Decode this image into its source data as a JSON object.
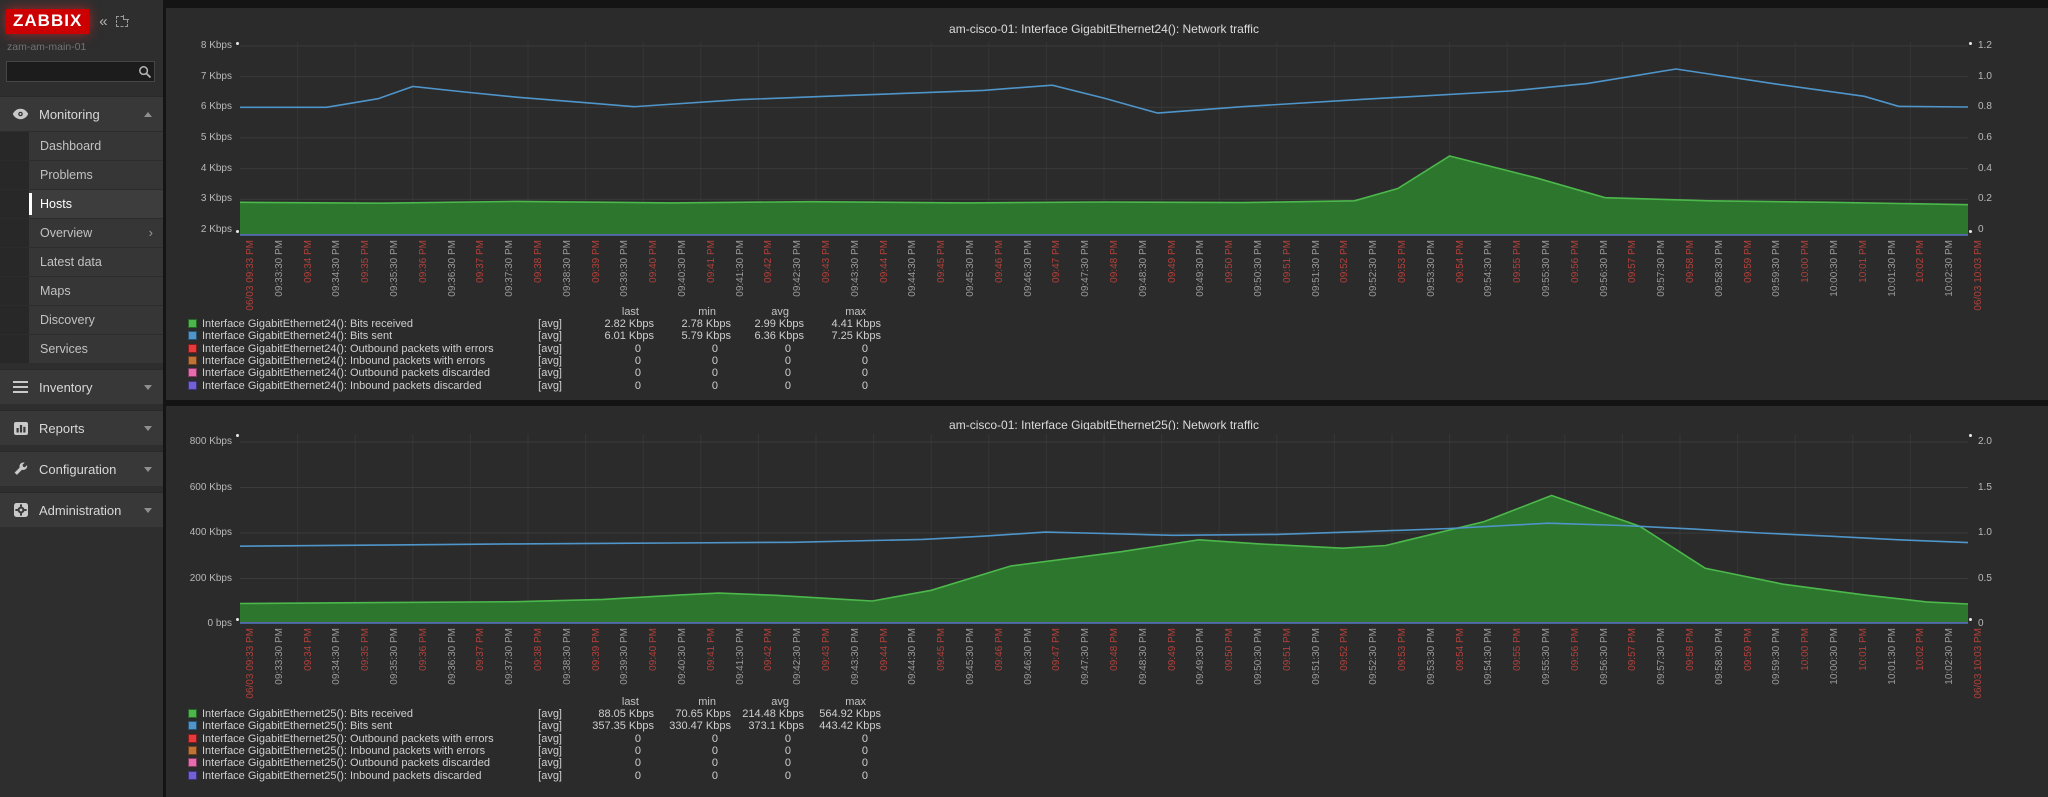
{
  "sidebar": {
    "logo_text": "ZABBIX",
    "collapse_icon": "«",
    "server_name": "zam-am-main-01",
    "search_placeholder": "",
    "menu": [
      {
        "id": "monitoring",
        "label": "Monitoring",
        "icon": "eye-icon",
        "state": "expanded",
        "items": [
          {
            "label": "Dashboard",
            "active": false,
            "has_submenu": false
          },
          {
            "label": "Problems",
            "active": false,
            "has_submenu": false
          },
          {
            "label": "Hosts",
            "active": true,
            "has_submenu": false
          },
          {
            "label": "Overview",
            "active": false,
            "has_submenu": true
          },
          {
            "label": "Latest data",
            "active": false,
            "has_submenu": false
          },
          {
            "label": "Maps",
            "active": false,
            "has_submenu": false
          },
          {
            "label": "Discovery",
            "active": false,
            "has_submenu": false
          },
          {
            "label": "Services",
            "active": false,
            "has_submenu": false
          }
        ]
      },
      {
        "id": "inventory",
        "label": "Inventory",
        "icon": "list-icon",
        "state": "collapsed",
        "items": []
      },
      {
        "id": "reports",
        "label": "Reports",
        "icon": "report-icon",
        "state": "collapsed",
        "items": []
      },
      {
        "id": "configuration",
        "label": "Configuration",
        "icon": "wrench-icon",
        "state": "collapsed",
        "items": []
      },
      {
        "id": "administration",
        "label": "Administration",
        "icon": "gear-icon",
        "state": "collapsed",
        "items": []
      }
    ]
  },
  "colors": {
    "received_green": "#4cb84c",
    "received_fill": "#2e7d2e",
    "sent_blue": "#4f95c9",
    "err_red": "#e83a3a",
    "err_orange": "#bf7436",
    "disc_pink": "#e86bb0",
    "disc_violet": "#7161d8",
    "x_label_red": "#b4403a",
    "axis_line": "#44689a"
  },
  "x_labels": [
    "06/03 09:33 PM",
    "09:33:30 PM",
    "09:34 PM",
    "09:34:30 PM",
    "09:35 PM",
    "09:35:30 PM",
    "09:36 PM",
    "09:36:30 PM",
    "09:37 PM",
    "09:37:30 PM",
    "09:38 PM",
    "09:38:30 PM",
    "09:39 PM",
    "09:39:30 PM",
    "09:40 PM",
    "09:40:30 PM",
    "09:41 PM",
    "09:41:30 PM",
    "09:42 PM",
    "09:42:30 PM",
    "09:43 PM",
    "09:43:30 PM",
    "09:44 PM",
    "09:44:30 PM",
    "09:45 PM",
    "09:45:30 PM",
    "09:46 PM",
    "09:46:30 PM",
    "09:47 PM",
    "09:47:30 PM",
    "09:48 PM",
    "09:48:30 PM",
    "09:49 PM",
    "09:49:30 PM",
    "09:50 PM",
    "09:50:30 PM",
    "09:51 PM",
    "09:51:30 PM",
    "09:52 PM",
    "09:52:30 PM",
    "09:53 PM",
    "09:53:30 PM",
    "09:54 PM",
    "09:54:30 PM",
    "09:55 PM",
    "09:55:30 PM",
    "09:56 PM",
    "09:56:30 PM",
    "09:57 PM",
    "09:57:30 PM",
    "09:58 PM",
    "09:58:30 PM",
    "09:59 PM",
    "09:59:30 PM",
    "10:00 PM",
    "10:00:30 PM",
    "10:01 PM",
    "10:01:30 PM",
    "10:02 PM",
    "10:02:30 PM",
    "06/03 10:03 PM"
  ],
  "legend_columns": [
    "last",
    "min",
    "avg",
    "max"
  ],
  "charts": [
    {
      "title": "am-cisco-01: Interface GigabitEthernet24(): Network traffic",
      "y_left": [
        {
          "label": "8 Kbps",
          "v": 8
        },
        {
          "label": "7 Kbps",
          "v": 7
        },
        {
          "label": "6 Kbps",
          "v": 6
        },
        {
          "label": "5 Kbps",
          "v": 5
        },
        {
          "label": "4 Kbps",
          "v": 4
        },
        {
          "label": "3 Kbps",
          "v": 3
        },
        {
          "label": "2 Kbps",
          "v": 2
        }
      ],
      "y_right": [
        "1.2",
        "1.0",
        "0.8",
        "0.6",
        "0.4",
        "0.2",
        "0"
      ],
      "legend_rows": [
        {
          "color": "#4cb84c",
          "label": "Interface GigabitEthernet24(): Bits received",
          "fn": "[avg]",
          "last": "2.82 Kbps",
          "min": "2.78 Kbps",
          "avg": "2.99 Kbps",
          "max": "4.41 Kbps"
        },
        {
          "color": "#4f95c9",
          "label": "Interface GigabitEthernet24(): Bits sent",
          "fn": "[avg]",
          "last": "6.01 Kbps",
          "min": "5.79 Kbps",
          "avg": "6.36 Kbps",
          "max": "7.25 Kbps"
        },
        {
          "color": "#e83a3a",
          "label": "Interface GigabitEthernet24(): Outbound packets with errors",
          "fn": "[avg]",
          "last": "0",
          "min": "0",
          "avg": "0",
          "max": "0"
        },
        {
          "color": "#bf7436",
          "label": "Interface GigabitEthernet24(): Inbound packets with errors",
          "fn": "[avg]",
          "last": "0",
          "min": "0",
          "avg": "0",
          "max": "0"
        },
        {
          "color": "#e86bb0",
          "label": "Interface GigabitEthernet24(): Outbound packets discarded",
          "fn": "[avg]",
          "last": "0",
          "min": "0",
          "avg": "0",
          "max": "0"
        },
        {
          "color": "#7161d8",
          "label": "Interface GigabitEthernet24(): Inbound packets discarded",
          "fn": "[avg]",
          "last": "0",
          "min": "0",
          "avg": "0",
          "max": "0"
        }
      ],
      "chart_data": {
        "type": "area",
        "title": "am-cisco-01: Interface GigabitEthernet24(): Network traffic",
        "x_range": [
          "06/03 09:33 PM",
          "06/03 10:03 PM"
        ],
        "x_tick_interval": "30s",
        "ylabel_left": "Kbps",
        "ylim_left": [
          1.8,
          8
        ],
        "yticks_left": [
          2,
          3,
          4,
          5,
          6,
          7,
          8
        ],
        "ylim_right": [
          0,
          1.2
        ],
        "grid": true,
        "series": [
          {
            "name": "Interface GigabitEthernet24(): Bits received",
            "type": "area",
            "unit": "Kbps",
            "points": [
              [
                0,
                2.9
              ],
              [
                0.08,
                2.87
              ],
              [
                0.16,
                2.93
              ],
              [
                0.25,
                2.88
              ],
              [
                0.33,
                2.92
              ],
              [
                0.42,
                2.88
              ],
              [
                0.5,
                2.91
              ],
              [
                0.58,
                2.89
              ],
              [
                0.645,
                2.95
              ],
              [
                0.67,
                3.35
              ],
              [
                0.7,
                4.41
              ],
              [
                0.75,
                3.7
              ],
              [
                0.79,
                3.05
              ],
              [
                0.85,
                2.95
              ],
              [
                0.92,
                2.9
              ],
              [
                1,
                2.82
              ]
            ]
          },
          {
            "name": "Interface GigabitEthernet24(): Bits sent",
            "type": "line",
            "unit": "Kbps",
            "points": [
              [
                0,
                6.0
              ],
              [
                0.05,
                6.0
              ],
              [
                0.08,
                6.28
              ],
              [
                0.1,
                6.68
              ],
              [
                0.13,
                6.5
              ],
              [
                0.16,
                6.33
              ],
              [
                0.2,
                6.15
              ],
              [
                0.228,
                6.02
              ],
              [
                0.29,
                6.25
              ],
              [
                0.35,
                6.38
              ],
              [
                0.43,
                6.55
              ],
              [
                0.47,
                6.72
              ],
              [
                0.5,
                6.3
              ],
              [
                0.531,
                5.81
              ],
              [
                0.58,
                6.02
              ],
              [
                0.65,
                6.26
              ],
              [
                0.735,
                6.53
              ],
              [
                0.78,
                6.78
              ],
              [
                0.831,
                7.25
              ],
              [
                0.89,
                6.75
              ],
              [
                0.94,
                6.36
              ],
              [
                0.96,
                6.03
              ],
              [
                1,
                6.01
              ]
            ]
          },
          {
            "name": "Interface GigabitEthernet24(): Outbound packets with errors",
            "type": "line",
            "points": [
              [
                0,
                0
              ],
              [
                1,
                0
              ]
            ]
          },
          {
            "name": "Interface GigabitEthernet24(): Inbound packets with errors",
            "type": "line",
            "points": [
              [
                0,
                0
              ],
              [
                1,
                0
              ]
            ]
          },
          {
            "name": "Interface GigabitEthernet24(): Outbound packets discarded",
            "type": "line",
            "points": [
              [
                0,
                0
              ],
              [
                1,
                0
              ]
            ]
          },
          {
            "name": "Interface GigabitEthernet24(): Inbound packets discarded",
            "type": "line",
            "points": [
              [
                0,
                0
              ],
              [
                1,
                0
              ]
            ]
          }
        ]
      }
    },
    {
      "title": "am-cisco-01: Interface GigabitEthernet25(): Network traffic",
      "y_left": [
        {
          "label": "800 Kbps",
          "v": 800
        },
        {
          "label": "600 Kbps",
          "v": 600
        },
        {
          "label": "400 Kbps",
          "v": 400
        },
        {
          "label": "200 Kbps",
          "v": 200
        },
        {
          "label": "0 bps",
          "v": 0
        }
      ],
      "y_right": [
        "2.0",
        "1.5",
        "1.0",
        "0.5",
        "0"
      ],
      "legend_rows": [
        {
          "color": "#4cb84c",
          "label": "Interface GigabitEthernet25(): Bits received",
          "fn": "[avg]",
          "last": "88.05 Kbps",
          "min": "70.65 Kbps",
          "avg": "214.48 Kbps",
          "max": "564.92 Kbps"
        },
        {
          "color": "#4f95c9",
          "label": "Interface GigabitEthernet25(): Bits sent",
          "fn": "[avg]",
          "last": "357.35 Kbps",
          "min": "330.47 Kbps",
          "avg": "373.1 Kbps",
          "max": "443.42 Kbps"
        },
        {
          "color": "#e83a3a",
          "label": "Interface GigabitEthernet25(): Outbound packets with errors",
          "fn": "[avg]",
          "last": "0",
          "min": "0",
          "avg": "0",
          "max": "0"
        },
        {
          "color": "#bf7436",
          "label": "Interface GigabitEthernet25(): Inbound packets with errors",
          "fn": "[avg]",
          "last": "0",
          "min": "0",
          "avg": "0",
          "max": "0"
        },
        {
          "color": "#e86bb0",
          "label": "Interface GigabitEthernet25(): Outbound packets discarded",
          "fn": "[avg]",
          "last": "0",
          "min": "0",
          "avg": "0",
          "max": "0"
        },
        {
          "color": "#7161d8",
          "label": "Interface GigabitEthernet25(): Inbound packets discarded",
          "fn": "[avg]",
          "last": "0",
          "min": "0",
          "avg": "0",
          "max": "0"
        }
      ],
      "chart_data": {
        "type": "area",
        "title": "am-cisco-01: Interface GigabitEthernet25(): Network traffic",
        "x_range": [
          "06/03 09:33 PM",
          "06/03 10:03 PM"
        ],
        "x_tick_interval": "30s",
        "ylabel_left": "Kbps",
        "ylim_left": [
          0,
          800
        ],
        "yticks_left": [
          0,
          200,
          400,
          600,
          800
        ],
        "ylim_right": [
          0,
          2.0
        ],
        "grid": true,
        "series": [
          {
            "name": "Interface GigabitEthernet25(): Bits received",
            "type": "area",
            "unit": "Kbps",
            "points": [
              [
                0,
                90
              ],
              [
                0.08,
                94
              ],
              [
                0.16,
                98
              ],
              [
                0.21,
                108
              ],
              [
                0.255,
                128
              ],
              [
                0.277,
                136
              ],
              [
                0.31,
                126
              ],
              [
                0.35,
                108
              ],
              [
                0.366,
                101
              ],
              [
                0.4,
                148
              ],
              [
                0.446,
                255
              ],
              [
                0.51,
                318
              ],
              [
                0.555,
                370
              ],
              [
                0.59,
                352
              ],
              [
                0.638,
                333
              ],
              [
                0.663,
                345
              ],
              [
                0.72,
                450
              ],
              [
                0.759,
                565
              ],
              [
                0.81,
                430
              ],
              [
                0.848,
                245
              ],
              [
                0.893,
                175
              ],
              [
                0.94,
                128
              ],
              [
                0.976,
                97
              ],
              [
                1,
                88
              ]
            ]
          },
          {
            "name": "Interface GigabitEthernet25(): Bits sent",
            "type": "line",
            "unit": "Kbps",
            "points": [
              [
                0,
                342
              ],
              [
                0.08,
                347
              ],
              [
                0.16,
                352
              ],
              [
                0.25,
                356
              ],
              [
                0.32,
                359
              ],
              [
                0.395,
                372
              ],
              [
                0.43,
                386
              ],
              [
                0.466,
                404
              ],
              [
                0.5,
                398
              ],
              [
                0.54,
                390
              ],
              [
                0.6,
                394
              ],
              [
                0.65,
                406
              ],
              [
                0.7,
                420
              ],
              [
                0.757,
                443
              ],
              [
                0.8,
                433
              ],
              [
                0.84,
                418
              ],
              [
                0.88,
                400
              ],
              [
                0.92,
                386
              ],
              [
                0.96,
                370
              ],
              [
                1,
                358
              ]
            ]
          },
          {
            "name": "Interface GigabitEthernet25(): Outbound packets with errors",
            "type": "line",
            "points": [
              [
                0,
                0
              ],
              [
                1,
                0
              ]
            ]
          },
          {
            "name": "Interface GigabitEthernet25(): Inbound packets with errors",
            "type": "line",
            "points": [
              [
                0,
                0
              ],
              [
                1,
                0
              ]
            ]
          },
          {
            "name": "Interface GigabitEthernet25(): Outbound packets discarded",
            "type": "line",
            "points": [
              [
                0,
                0
              ],
              [
                1,
                0
              ]
            ]
          },
          {
            "name": "Interface GigabitEthernet25(): Inbound packets discarded",
            "type": "line",
            "points": [
              [
                0,
                0
              ],
              [
                1,
                0
              ]
            ]
          }
        ]
      }
    }
  ]
}
